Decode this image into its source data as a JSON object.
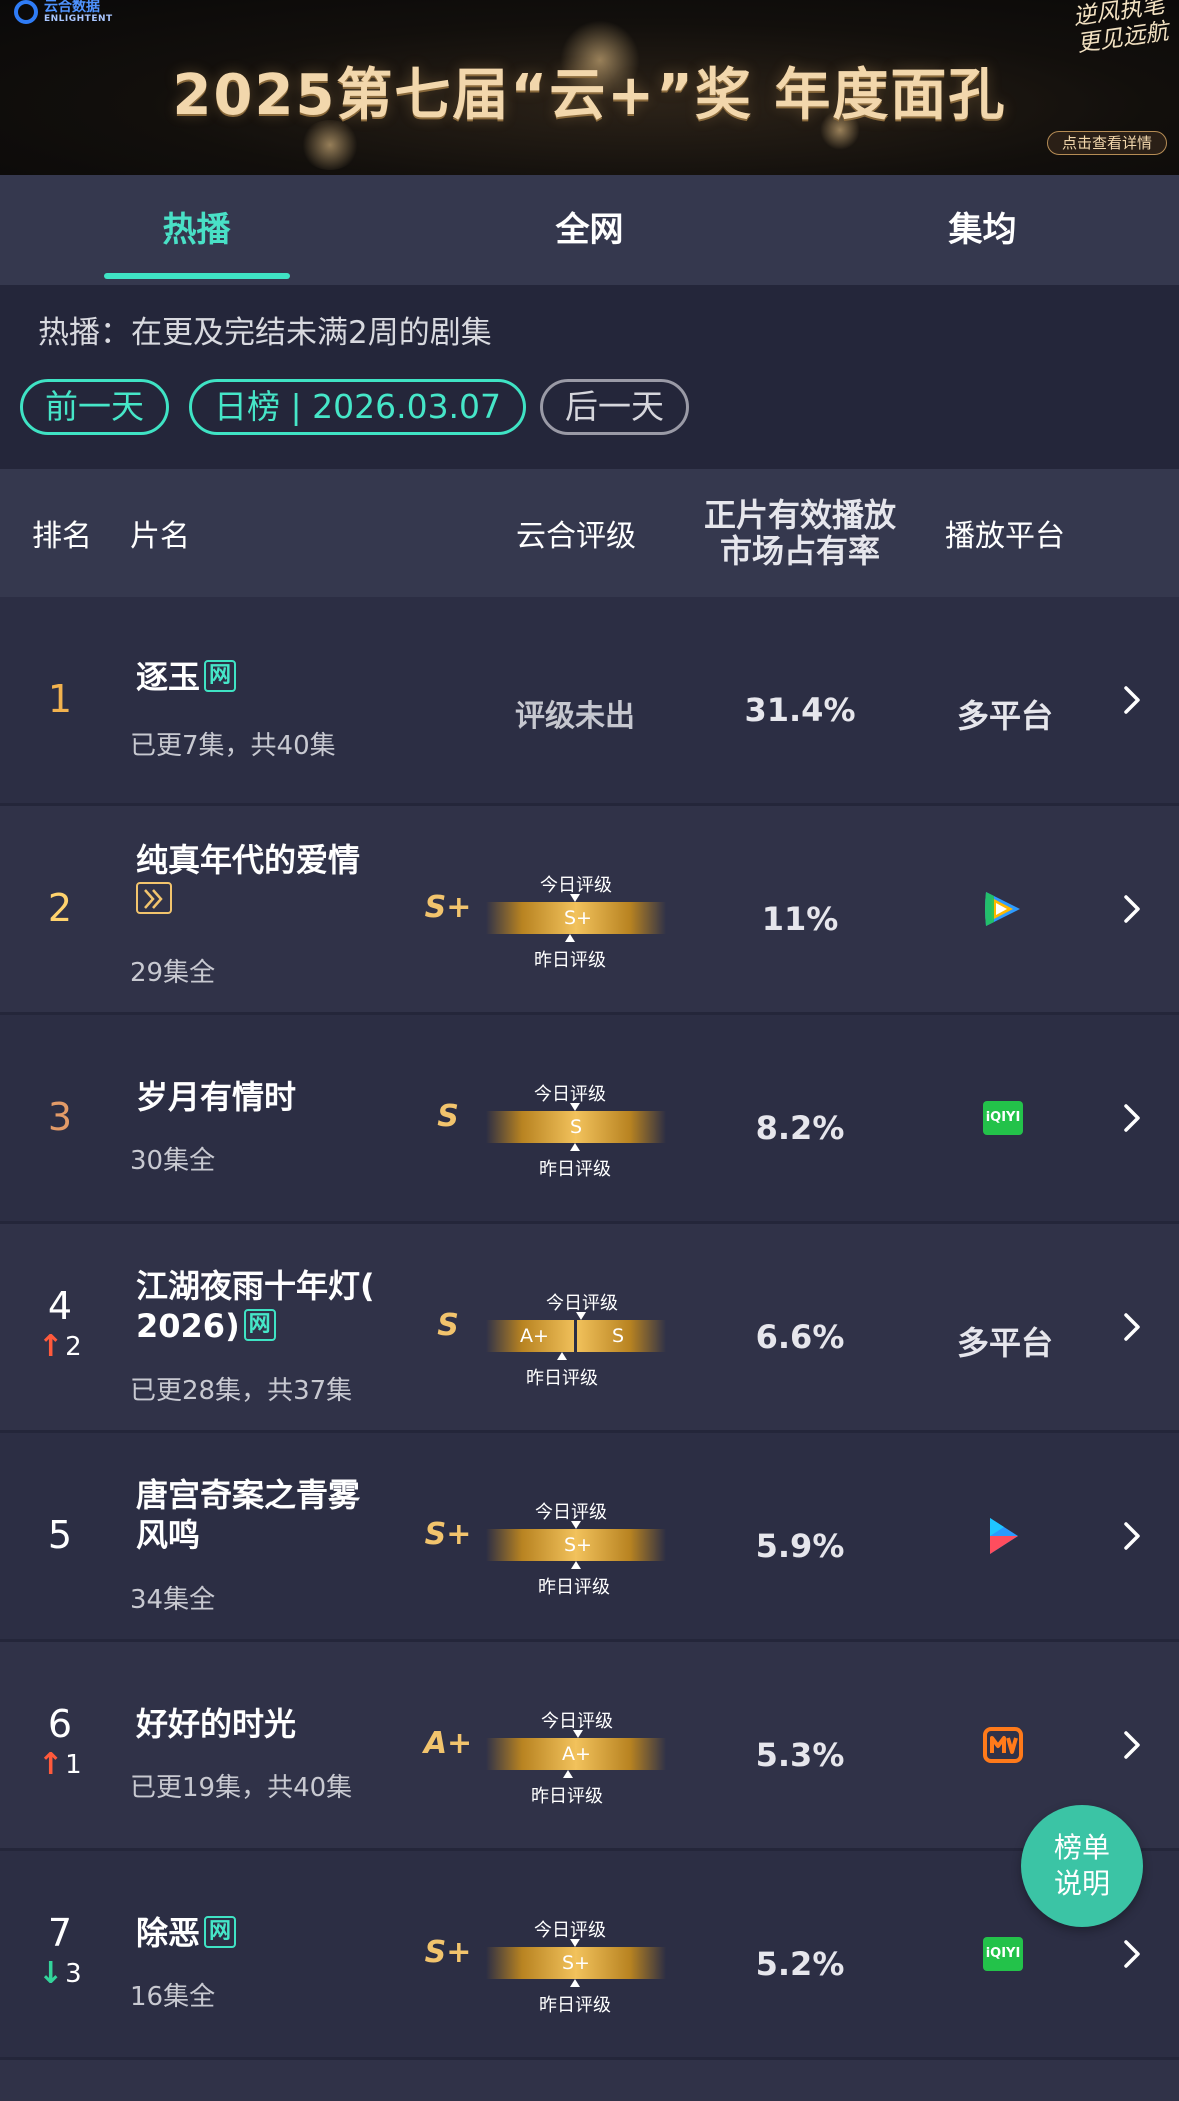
{
  "banner": {
    "logo_cn": "云合数据",
    "logo_en": "ENLIGHTENT",
    "title": "2025第七届“云+”奖  年度面孔",
    "slogan": "逆风执笔 更见远航",
    "detail_label": "点击查看详情"
  },
  "tabs": [
    {
      "label": "热播",
      "active": true
    },
    {
      "label": "全网",
      "active": false
    },
    {
      "label": "集均",
      "active": false
    }
  ],
  "filter": {
    "description": "热播：在更及完结未满2周的剧集",
    "prev_label": "前一天",
    "date_label": "日榜 | 2026.03.07",
    "next_label": "后一天"
  },
  "table_header": {
    "rank": "排名",
    "name": "片名",
    "rating": "云合评级",
    "share_line1": "正片有效播放",
    "share_line2": "市场占有率",
    "platform": "播放平台"
  },
  "rating_labels": {
    "today": "今日评级",
    "yesterday": "昨日评级"
  },
  "rows": [
    {
      "rank": "1",
      "title": "逐玉",
      "badge": "网",
      "episodes": "已更7集，共40集",
      "rating_text": "评级未出",
      "share": "31.4%",
      "platform_text": "多平台"
    },
    {
      "rank": "2",
      "title": "纯真年代的爱情",
      "badge": "play",
      "episodes": "29集全",
      "grade": "S+",
      "today": "S+",
      "share": "11%",
      "platform_icon": "tencent-video-icon"
    },
    {
      "rank": "3",
      "title": "岁月有情时",
      "episodes": "30集全",
      "grade": "S",
      "today": "S",
      "share": "8.2%",
      "platform_icon": "iqiyi-icon",
      "platform_icon_text": "iQIYI"
    },
    {
      "rank": "4",
      "change": "2",
      "change_dir": "up",
      "title_line1": "江湖夜雨十年灯(",
      "title_line2": "2026)",
      "badge": "网",
      "episodes": "已更28集，共37集",
      "grade": "S",
      "yesterday": "A+",
      "today": "S",
      "share": "6.6%",
      "platform_text": "多平台"
    },
    {
      "rank": "5",
      "title_line1": "唐宫奇案之青雾",
      "title_line2": "风鸣",
      "episodes": "34集全",
      "grade": "S+",
      "today": "S+",
      "share": "5.9%",
      "platform_icon": "youku-icon"
    },
    {
      "rank": "6",
      "change": "1",
      "change_dir": "up",
      "title": "好好的时光",
      "episodes": "已更19集，共40集",
      "grade": "A+",
      "today": "A+",
      "share": "5.3%",
      "platform_icon": "mango-tv-icon"
    },
    {
      "rank": "7",
      "change": "3",
      "change_dir": "down",
      "title": "除恶",
      "badge": "网",
      "episodes": "16集全",
      "grade": "S+",
      "today": "S+",
      "share": "5.2%",
      "platform_icon": "iqiyi-icon",
      "platform_icon_text": "iQIYI"
    }
  ],
  "float_button": {
    "line1": "榜单",
    "line2": "说明"
  },
  "colors": {
    "accent": "#3fe3c4",
    "gold": "#f2c46d",
    "row_bg": "#2c2e44",
    "header_bg": "#35384e"
  }
}
